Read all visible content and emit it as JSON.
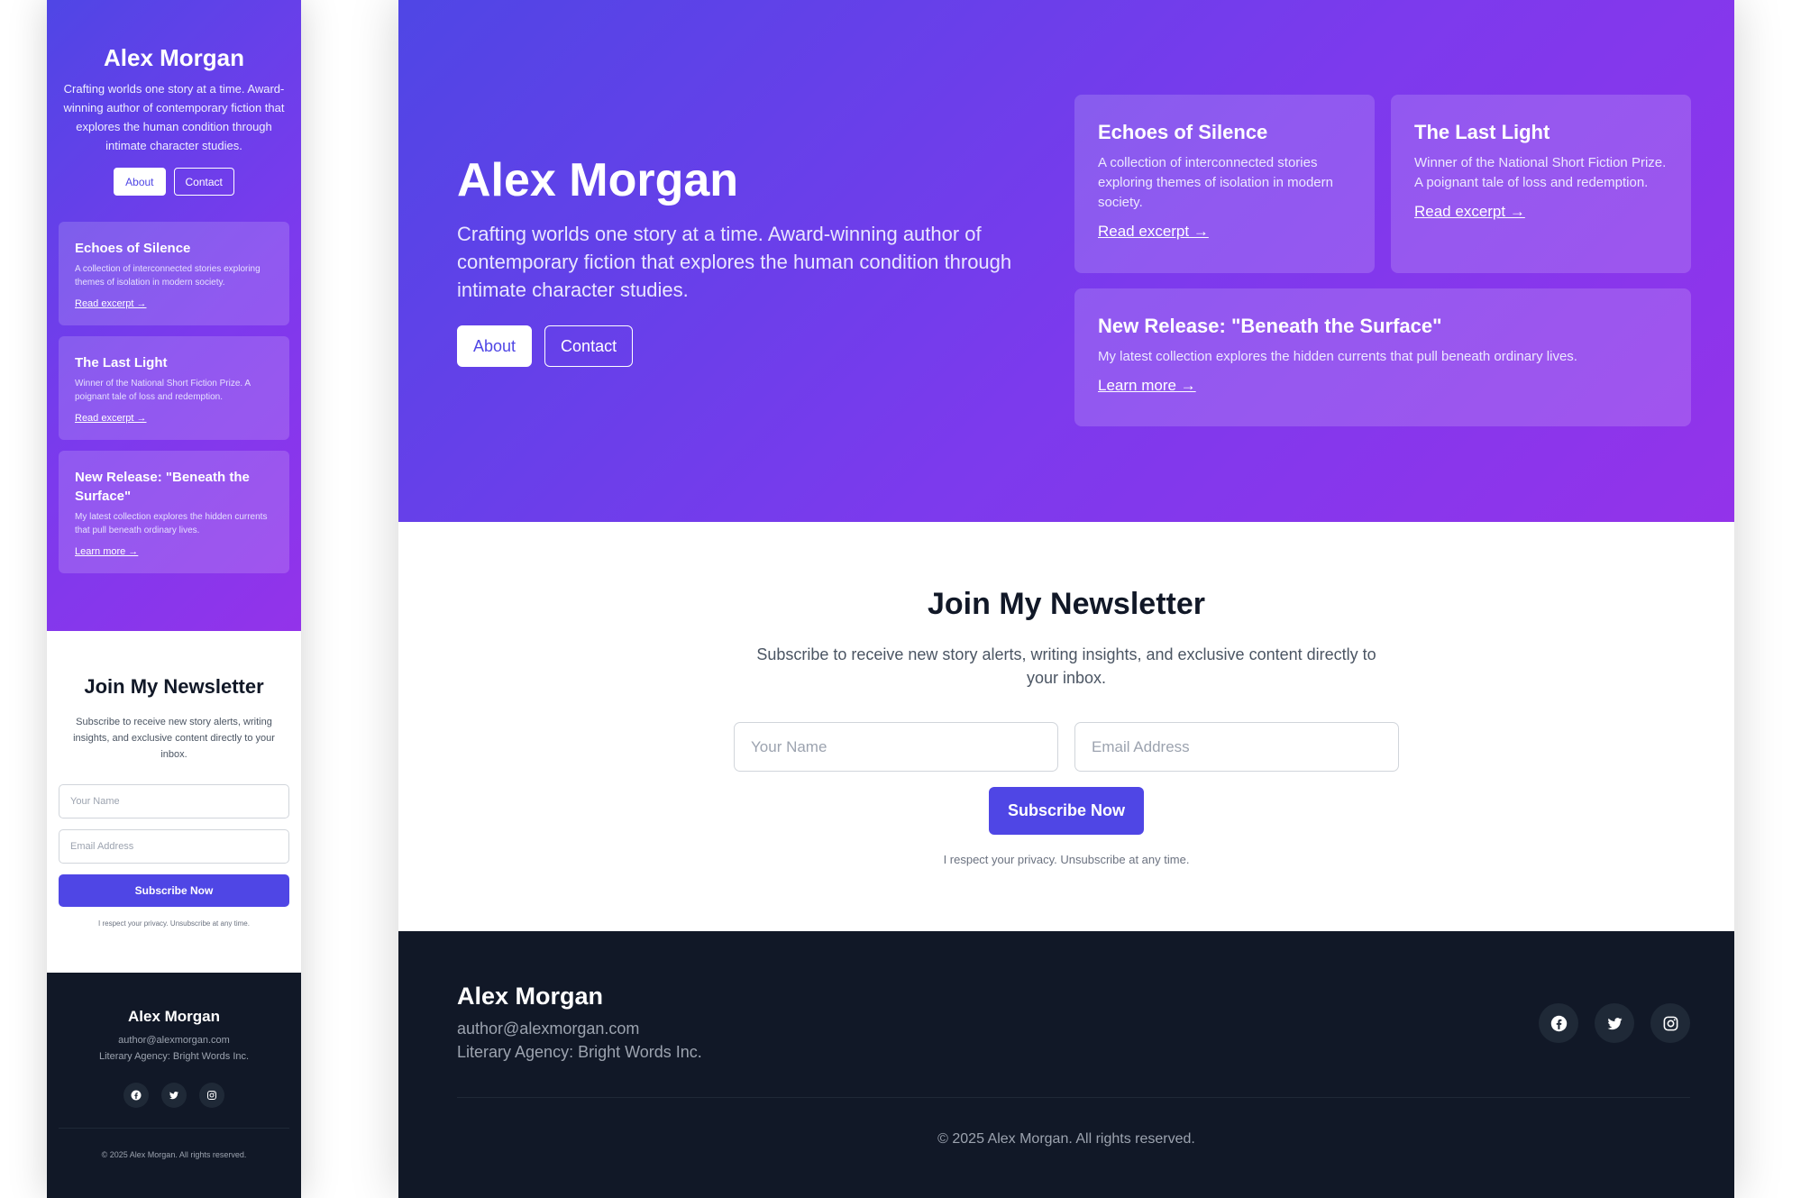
{
  "author": {
    "name": "Alex Morgan",
    "tagline": "Crafting worlds one story at a time. Award-winning author of contemporary fiction that explores the human condition through intimate character studies."
  },
  "nav": {
    "about_label": "About",
    "contact_label": "Contact"
  },
  "cards": [
    {
      "title": "Echoes of Silence",
      "text": "A collection of interconnected stories exploring themes of isolation in modern society.",
      "link": "Read excerpt →"
    },
    {
      "title": "The Last Light",
      "text": "Winner of the National Short Fiction Prize. A poignant tale of loss and redemption.",
      "link": "Read excerpt →"
    },
    {
      "title": "New Release: \"Beneath the Surface\"",
      "text": "My latest collection explores the hidden currents that pull beneath ordinary lives.",
      "link": "Learn more →"
    }
  ],
  "newsletter": {
    "title": "Join My Newsletter",
    "description": "Subscribe to receive new story alerts, writing insights, and exclusive content directly to your inbox.",
    "name_placeholder": "Your Name",
    "email_placeholder": "Email Address",
    "submit_label": "Subscribe Now",
    "privacy": "I respect your privacy. Unsubscribe at any time."
  },
  "footer": {
    "name": "Alex Morgan",
    "email": "author@alexmorgan.com",
    "agency": "Literary Agency: Bright Words Inc.",
    "social_icons": [
      "facebook-icon",
      "twitter-icon",
      "instagram-icon"
    ],
    "copyright": "© 2025 Alex Morgan. All rights reserved."
  },
  "colors": {
    "accent": "#4f46e5",
    "gradient_start": "#4f46e5",
    "gradient_end": "#9333ea",
    "footer_bg": "#111827"
  }
}
